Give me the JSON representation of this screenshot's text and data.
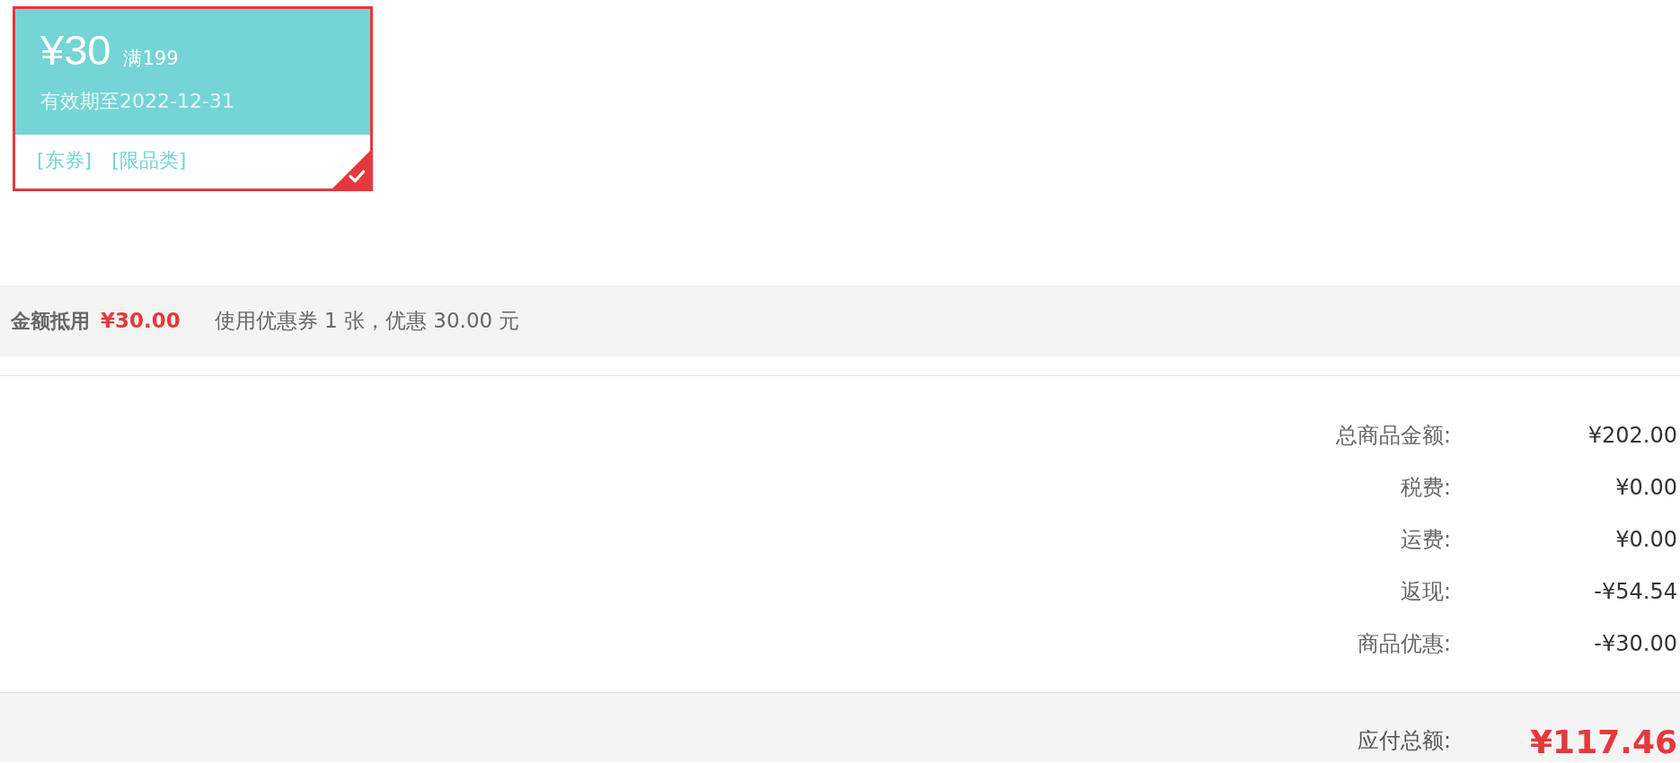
{
  "coupons": [
    {
      "amount": "¥30",
      "condition": "满199",
      "validity": "有效期至2022-12-31",
      "tags": [
        "[东券]",
        "[限品类]"
      ],
      "selected": true
    }
  ],
  "discount_bar": {
    "label": "金额抵用",
    "amount": "¥30.00",
    "summary": "使用优惠券 1 张，优惠 30.00 元"
  },
  "summary": [
    {
      "label": "总商品金额:",
      "value": "¥202.00"
    },
    {
      "label": "税费:",
      "value": "¥0.00"
    },
    {
      "label": "运费:",
      "value": "¥0.00"
    },
    {
      "label": "返现:",
      "value": "-¥54.54"
    },
    {
      "label": "商品优惠:",
      "value": "-¥30.00"
    }
  ],
  "total": {
    "label": "应付总额:",
    "value": "¥117.46"
  }
}
